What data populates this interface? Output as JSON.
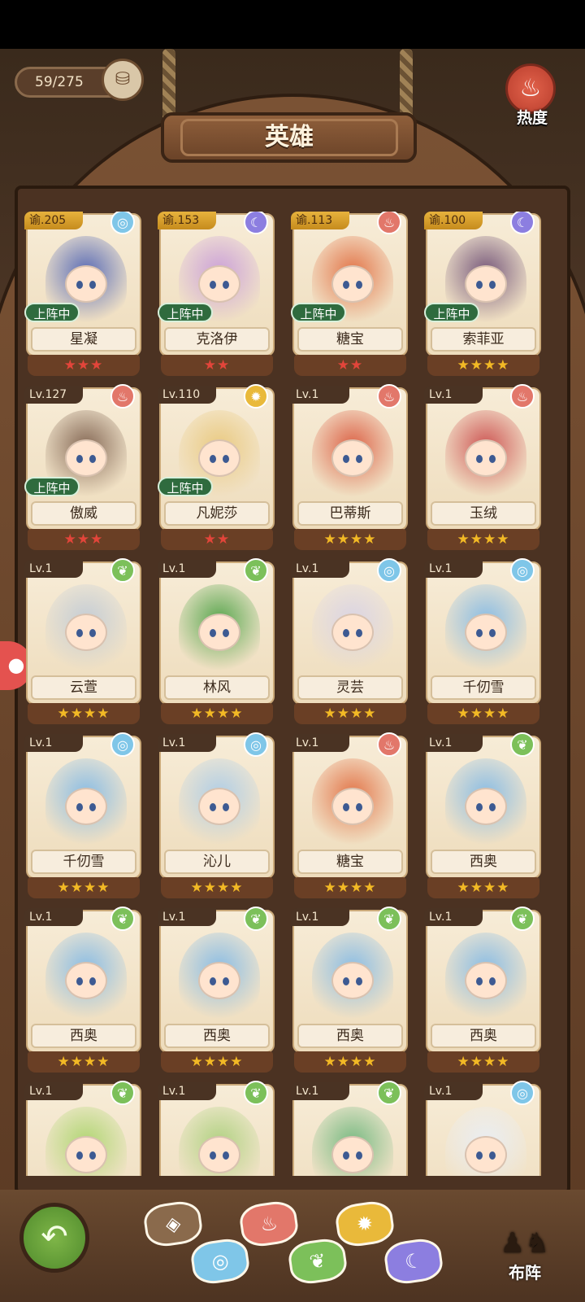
{
  "header": {
    "count": "59/275",
    "title": "英雄",
    "heat_label": "热度"
  },
  "elements": {
    "water": {
      "icon": "water-swirl-icon",
      "color": "#7fc6e8",
      "glyph": "◎"
    },
    "moon": {
      "icon": "moon-icon",
      "color": "#8c7ee0",
      "glyph": "☾"
    },
    "fire": {
      "icon": "fire-icon",
      "color": "#e2776a",
      "glyph": "♨"
    },
    "sun": {
      "icon": "sun-icon",
      "color": "#e9b93a",
      "glyph": "✹"
    },
    "leaf": {
      "icon": "leaf-icon",
      "color": "#7cc05a",
      "glyph": "❦"
    }
  },
  "on_team_label": "上阵中",
  "heroes": [
    {
      "level": "谕.205",
      "gold": true,
      "element": "water",
      "name": "星凝",
      "stars": "★★★",
      "star_color": "red",
      "on_team": true,
      "art": "#4a5fb3"
    },
    {
      "level": "谕.153",
      "gold": true,
      "element": "moon",
      "name": "克洛伊",
      "stars": "★★",
      "star_color": "red",
      "on_team": true,
      "art": "#c79ad9"
    },
    {
      "level": "谕.113",
      "gold": true,
      "element": "fire",
      "name": "糖宝",
      "stars": "★★",
      "star_color": "red",
      "on_team": true,
      "art": "#e06a3c"
    },
    {
      "level": "谕.100",
      "gold": true,
      "element": "moon",
      "name": "索菲亚",
      "stars": "★★★★",
      "star_color": "gold",
      "on_team": true,
      "art": "#6a4a72"
    },
    {
      "level": "Lv.127",
      "gold": false,
      "element": "fire",
      "name": "傲威",
      "stars": "★★★",
      "star_color": "red",
      "on_team": true,
      "art": "#7b5d4a"
    },
    {
      "level": "Lv.110",
      "gold": false,
      "element": "sun",
      "name": "凡妮莎",
      "stars": "★★",
      "star_color": "red",
      "on_team": true,
      "art": "#e8c77a"
    },
    {
      "level": "Lv.1",
      "gold": false,
      "element": "fire",
      "name": "巴蒂斯",
      "stars": "★★★★",
      "star_color": "gold",
      "on_team": false,
      "art": "#d9563a"
    },
    {
      "level": "Lv.1",
      "gold": false,
      "element": "fire",
      "name": "玉绒",
      "stars": "★★★★",
      "star_color": "gold",
      "on_team": false,
      "art": "#c94848"
    },
    {
      "level": "Lv.1",
      "gold": false,
      "element": "leaf",
      "name": "云萱",
      "stars": "★★★★",
      "star_color": "gold",
      "on_team": false,
      "art": "#bfcad6"
    },
    {
      "level": "Lv.1",
      "gold": false,
      "element": "leaf",
      "name": "林风",
      "stars": "★★★★",
      "star_color": "gold",
      "on_team": false,
      "art": "#4aa042"
    },
    {
      "level": "Lv.1",
      "gold": false,
      "element": "water",
      "name": "灵芸",
      "stars": "★★★★",
      "star_color": "gold",
      "on_team": false,
      "art": "#d7d2e6"
    },
    {
      "level": "Lv.1",
      "gold": false,
      "element": "water",
      "name": "千仞雪",
      "stars": "★★★★",
      "star_color": "gold",
      "on_team": false,
      "art": "#7fb8e6"
    },
    {
      "level": "Lv.1",
      "gold": false,
      "element": "water",
      "name": "千仞雪",
      "stars": "★★★★",
      "star_color": "gold",
      "on_team": false,
      "art": "#7fb8e6"
    },
    {
      "level": "Lv.1",
      "gold": false,
      "element": "water",
      "name": "沁儿",
      "stars": "★★★★",
      "star_color": "gold",
      "on_team": false,
      "art": "#a9cbe8"
    },
    {
      "level": "Lv.1",
      "gold": false,
      "element": "fire",
      "name": "糖宝",
      "stars": "★★★★",
      "star_color": "gold",
      "on_team": false,
      "art": "#e06a3c"
    },
    {
      "level": "Lv.1",
      "gold": false,
      "element": "leaf",
      "name": "西奥",
      "stars": "★★★★",
      "star_color": "gold",
      "on_team": false,
      "art": "#7fb8e6"
    },
    {
      "level": "Lv.1",
      "gold": false,
      "element": "leaf",
      "name": "西奥",
      "stars": "★★★★",
      "star_color": "gold",
      "on_team": false,
      "art": "#7fb8e6"
    },
    {
      "level": "Lv.1",
      "gold": false,
      "element": "leaf",
      "name": "西奥",
      "stars": "★★★★",
      "star_color": "gold",
      "on_team": false,
      "art": "#7fb8e6"
    },
    {
      "level": "Lv.1",
      "gold": false,
      "element": "leaf",
      "name": "西奥",
      "stars": "★★★★",
      "star_color": "gold",
      "on_team": false,
      "art": "#7fb8e6"
    },
    {
      "level": "Lv.1",
      "gold": false,
      "element": "leaf",
      "name": "西奥",
      "stars": "★★★★",
      "star_color": "gold",
      "on_team": false,
      "art": "#7fb8e6"
    },
    {
      "level": "Lv.1",
      "gold": false,
      "element": "leaf",
      "name": "",
      "stars": "",
      "star_color": "gold",
      "on_team": false,
      "art": "#a9d46a"
    },
    {
      "level": "Lv.1",
      "gold": false,
      "element": "leaf",
      "name": "",
      "stars": "",
      "star_color": "gold",
      "on_team": false,
      "art": "#a9cf7a"
    },
    {
      "level": "Lv.1",
      "gold": false,
      "element": "leaf",
      "name": "",
      "stars": "",
      "star_color": "gold",
      "on_team": false,
      "art": "#6bb57a"
    },
    {
      "level": "Lv.1",
      "gold": false,
      "element": "water",
      "name": "",
      "stars": "",
      "star_color": "gold",
      "on_team": false,
      "art": "#e8eef7"
    }
  ],
  "filters": [
    {
      "id": "all",
      "icon": "all-diamond-icon",
      "glyph": "◈",
      "color": "#8a6a4c"
    },
    {
      "id": "water",
      "icon": "water-swirl-icon",
      "glyph": "◎",
      "color": "#7fc6e8"
    },
    {
      "id": "fire",
      "icon": "fire-icon",
      "glyph": "♨",
      "color": "#e2776a"
    },
    {
      "id": "leaf",
      "icon": "leaf-icon",
      "glyph": "❦",
      "color": "#7cc05a"
    },
    {
      "id": "sun",
      "icon": "sun-icon",
      "glyph": "✹",
      "color": "#e9b93a"
    },
    {
      "id": "moon",
      "icon": "moon-icon",
      "glyph": "☾",
      "color": "#8c7ee0"
    }
  ],
  "formation_label": "布阵"
}
